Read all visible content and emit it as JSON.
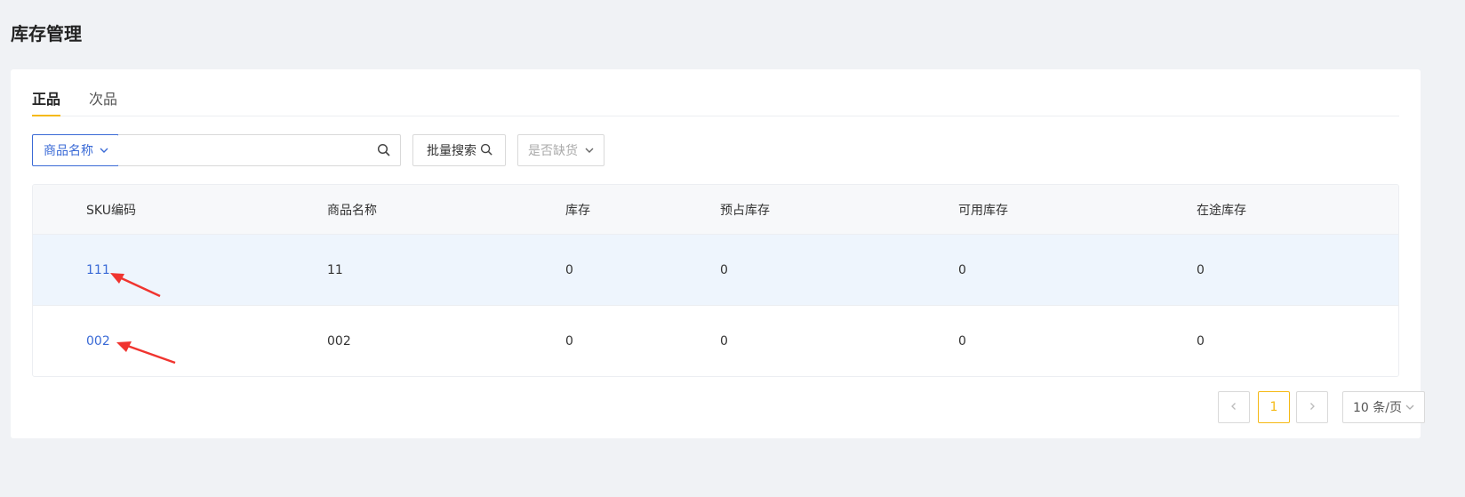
{
  "page": {
    "title": "库存管理"
  },
  "tabs": [
    {
      "label": "正品",
      "active": true
    },
    {
      "label": "次品",
      "active": false
    }
  ],
  "filters": {
    "field_select_value": "商品名称",
    "search_value": "",
    "search_placeholder": "",
    "batch_search_label": "批量搜索",
    "stock_select_placeholder": "是否缺货"
  },
  "table": {
    "columns": [
      "SKU编码",
      "商品名称",
      "库存",
      "预占库存",
      "可用库存",
      "在途库存"
    ],
    "rows": [
      {
        "sku": "111",
        "name": "11",
        "stock": "0",
        "reserved": "0",
        "available": "0",
        "in_transit": "0"
      },
      {
        "sku": "002",
        "name": "002",
        "stock": "0",
        "reserved": "0",
        "available": "0",
        "in_transit": "0"
      }
    ]
  },
  "pagination": {
    "current_page": "1",
    "page_size": "10 条/页"
  },
  "colors": {
    "accent_blue": "#3a6ad6",
    "accent_yellow": "#f5b914",
    "annotation_red": "#f0342f",
    "row_hover": "#eef5fd"
  }
}
